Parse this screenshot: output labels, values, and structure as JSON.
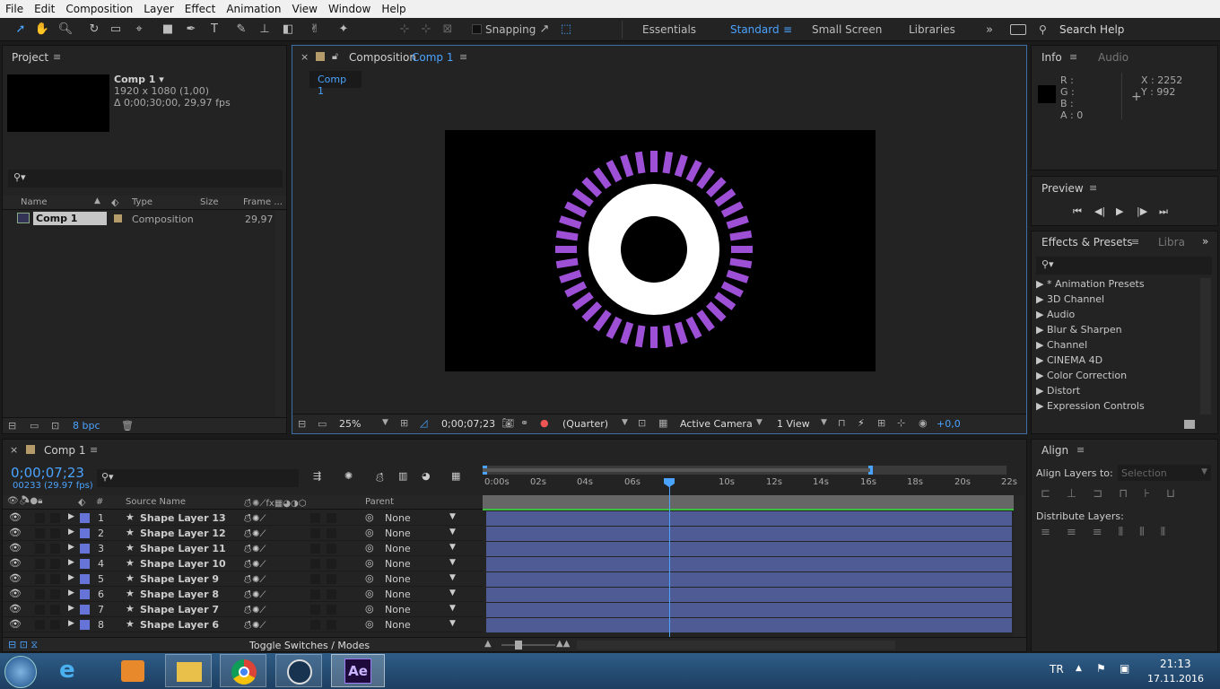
{
  "menu": [
    "File",
    "Edit",
    "Composition",
    "Layer",
    "Effect",
    "Animation",
    "View",
    "Window",
    "Help"
  ],
  "toolbar": {
    "snapping": "Snapping",
    "workspaces": [
      "Essentials",
      "Standard",
      "Small Screen",
      "Libraries"
    ],
    "search": "Search Help"
  },
  "project": {
    "title": "Project",
    "comp_name": "Comp 1 ▾",
    "comp_res": "1920 x 1080 (1,00)",
    "comp_dur": "Δ 0;00;30;00, 29,97 fps",
    "cols": [
      "Name",
      "Type",
      "Size",
      "Frame ..."
    ],
    "item": {
      "name": "Comp 1",
      "type": "Composition",
      "fps": "29,97"
    },
    "bpc": "8 bpc"
  },
  "viewer": {
    "title": "Composition",
    "title_comp": "Comp 1",
    "tab": "Comp 1",
    "zoom": "25%",
    "time": "0;00;07;23",
    "res": "(Quarter)",
    "camera": "Active Camera",
    "views": "1 View",
    "exposure": "+0,0"
  },
  "info": {
    "tabs": [
      "Info",
      "Audio"
    ],
    "r": "R :",
    "g": "G :",
    "b": "B :",
    "a": "A : 0",
    "x": "X : 2252",
    "y": "Y : 992"
  },
  "preview": {
    "title": "Preview"
  },
  "effects": {
    "title": "Effects & Presets",
    "tab2": "Libra",
    "items": [
      "* Animation Presets",
      "3D Channel",
      "Audio",
      "Blur & Sharpen",
      "Channel",
      "CINEMA 4D",
      "Color Correction",
      "Distort",
      "Expression Controls"
    ]
  },
  "timeline": {
    "tab": "Comp 1",
    "timecode": "0;00;07;23",
    "frames": "00233 (29.97 fps)",
    "col_source": "Source Name",
    "col_parent": "Parent",
    "toggle": "Toggle Switches / Modes",
    "ruler": [
      "0:00s",
      "02s",
      "04s",
      "06s",
      "10s",
      "12s",
      "14s",
      "16s",
      "18s",
      "20s",
      "22s"
    ],
    "layers": [
      {
        "n": "1",
        "name": "Shape Layer 13",
        "parent": "None"
      },
      {
        "n": "2",
        "name": "Shape Layer 12",
        "parent": "None"
      },
      {
        "n": "3",
        "name": "Shape Layer 11",
        "parent": "None"
      },
      {
        "n": "4",
        "name": "Shape Layer 10",
        "parent": "None"
      },
      {
        "n": "5",
        "name": "Shape Layer 9",
        "parent": "None"
      },
      {
        "n": "6",
        "name": "Shape Layer 8",
        "parent": "None"
      },
      {
        "n": "7",
        "name": "Shape Layer 7",
        "parent": "None"
      },
      {
        "n": "8",
        "name": "Shape Layer 6",
        "parent": "None"
      }
    ]
  },
  "align": {
    "title": "Align",
    "align_to_label": "Align Layers to:",
    "align_to_value": "Selection",
    "distribute": "Distribute Layers:"
  },
  "taskbar": {
    "lang": "TR",
    "time": "21:13",
    "date": "17.11.2016"
  },
  "colors": {
    "accent": "#2d8ceb",
    "purple": "#9d4fd6",
    "layer": "#4f5b94",
    "label": "#6674d8"
  }
}
